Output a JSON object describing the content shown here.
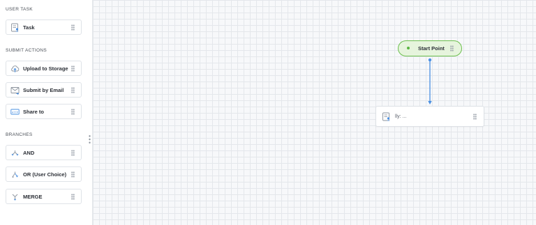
{
  "sidebar": {
    "sections": [
      {
        "title": "USER TASK",
        "items": [
          {
            "label": "Task",
            "icon": "task-icon"
          }
        ]
      },
      {
        "title": "SUBMIT ACTIONS",
        "items": [
          {
            "label": "Upload to Storage",
            "icon": "cloud-upload-icon"
          },
          {
            "label": "Submit by Email",
            "icon": "email-icon"
          },
          {
            "label": "Share to",
            "icon": "share-icon"
          }
        ]
      },
      {
        "title": "BRANCHES",
        "items": [
          {
            "label": "AND",
            "icon": "and-branch-icon"
          },
          {
            "label": "OR (User Choice)",
            "icon": "or-branch-icon"
          },
          {
            "label": "MERGE",
            "icon": "merge-icon"
          }
        ]
      }
    ],
    "share_icon_text": "HTTP"
  },
  "canvas": {
    "start_node": {
      "label": "Start Point",
      "icon": "start-dot-icon"
    },
    "task_node": {
      "label": "lly: ...",
      "icon": "task-icon"
    }
  },
  "colors": {
    "accent": "#4a90e2",
    "start_fill": "#e6f4dd",
    "start_border": "#6cbf4e",
    "grid": "#e4e7eb"
  }
}
